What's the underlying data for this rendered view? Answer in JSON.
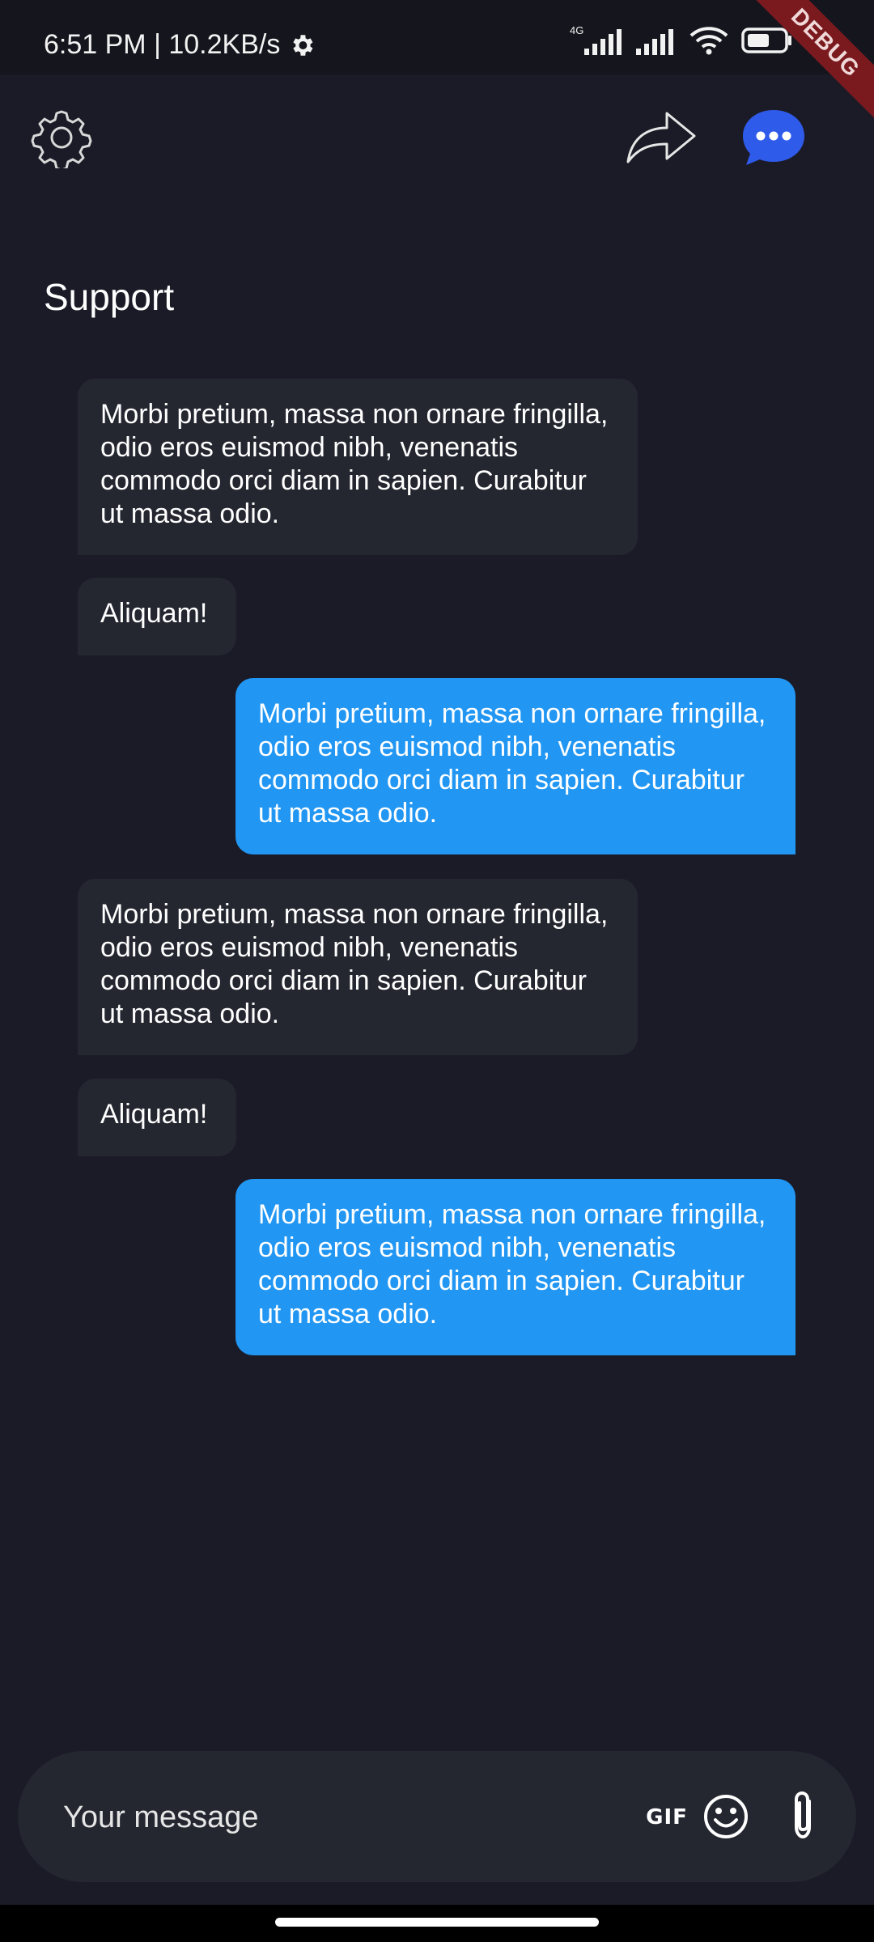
{
  "status_bar": {
    "time_text": "6:51 PM | 10.2KB/s",
    "battery_percent": "52",
    "network_label": "4G",
    "debug_label": "DEBUG"
  },
  "header": {
    "title": "Support",
    "icons": [
      "settings-gear-icon",
      "share-forward-icon",
      "chat-bubble-dots-icon"
    ],
    "accent_color": "#2f5bea"
  },
  "messages": [
    {
      "direction": "incoming",
      "text": "Morbi pretium, massa non ornare fringilla, odio eros euismod nibh, venenatis commodo orci diam in sapien. Curabitur ut massa odio."
    },
    {
      "direction": "incoming",
      "text": "Aliquam!"
    },
    {
      "direction": "outgoing",
      "text": "Morbi pretium, massa non ornare fringilla, odio eros euismod nibh, venenatis commodo orci diam in sapien. Curabitur ut massa odio."
    },
    {
      "direction": "incoming",
      "text": "Morbi pretium, massa non ornare fringilla, odio eros euismod nibh, venenatis commodo orci diam in sapien. Curabitur ut massa odio."
    },
    {
      "direction": "incoming",
      "text": "Aliquam!"
    },
    {
      "direction": "outgoing",
      "text": "Morbi pretium, massa non ornare fringilla, odio eros euismod nibh, venenatis commodo orci diam in sapien. Curabitur ut massa odio."
    }
  ],
  "composer": {
    "placeholder": "Your message",
    "gif_label": "GIF",
    "icons": [
      "gif-icon",
      "emoji-icon",
      "attachment-paperclip-icon"
    ]
  },
  "colors": {
    "background": "#1b1b27",
    "incoming_bubble": "#242630",
    "outgoing_bubble": "#2196f3"
  }
}
